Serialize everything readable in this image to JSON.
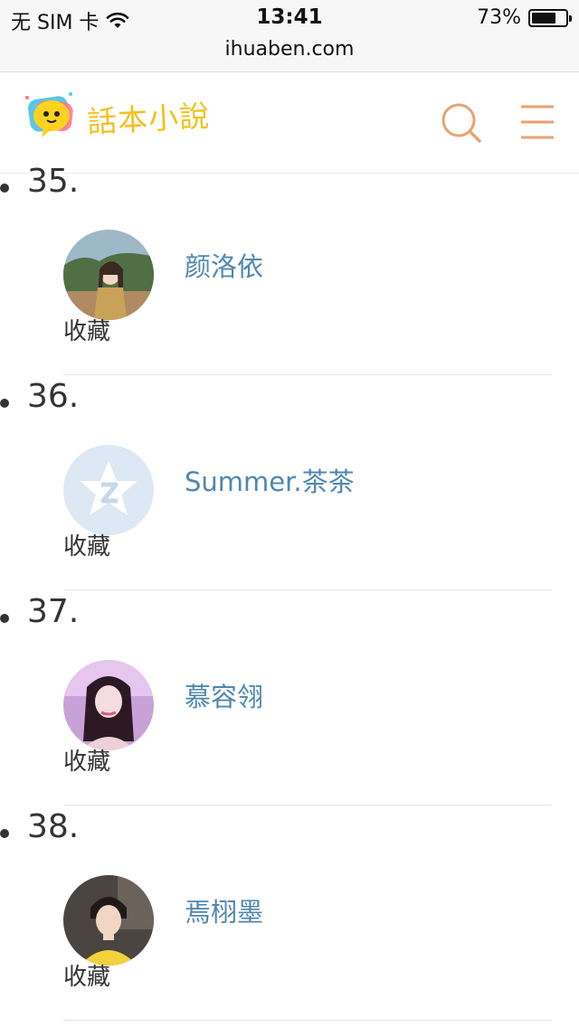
{
  "status_bar": {
    "carrier": "无 SIM 卡",
    "time": "13:41",
    "battery_percent": "73%",
    "battery_level": 0.73
  },
  "browser": {
    "url": "ihuaben.com"
  },
  "header": {
    "logo_text": "話本小說",
    "search_icon": "search-icon",
    "menu_icon": "menu-icon",
    "accent_color": "#e9a26f"
  },
  "entries": [
    {
      "number": "35.",
      "name": "颜洛依",
      "action": "收藏"
    },
    {
      "number": "36.",
      "name": "Summer.茶茶",
      "action": "收藏"
    },
    {
      "number": "37.",
      "name": "慕容翎",
      "action": "收藏"
    },
    {
      "number": "38.",
      "name": "焉栩墨",
      "action": "收藏"
    }
  ],
  "colors": {
    "link": "#4f87b0",
    "text": "#333333"
  }
}
